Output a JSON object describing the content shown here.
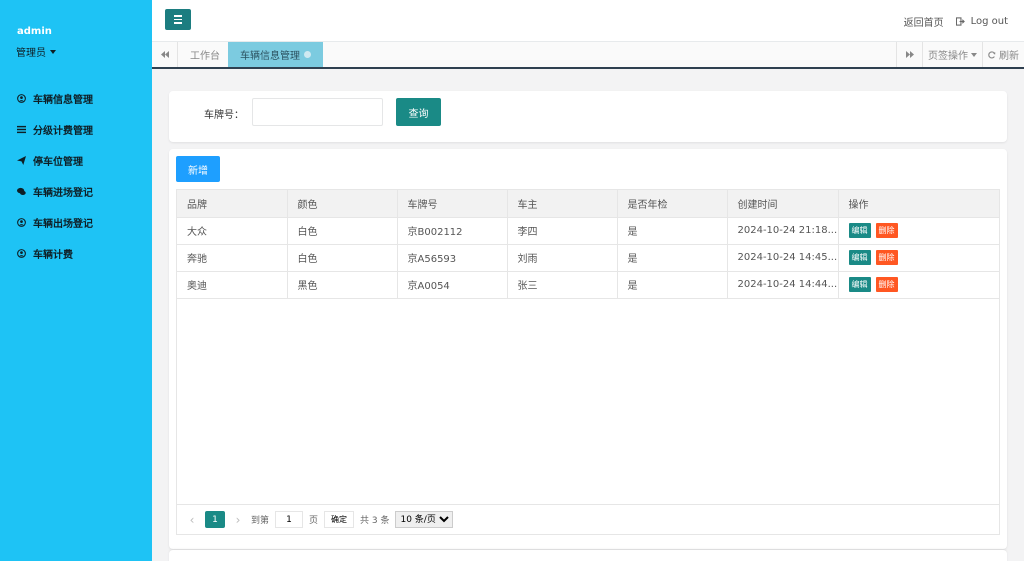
{
  "sidebar": {
    "user": "admin",
    "role": "管理员",
    "items": [
      {
        "label": "车辆信息管理",
        "icon": "user-circle-icon"
      },
      {
        "label": "分级计费管理",
        "icon": "list-icon"
      },
      {
        "label": "停车位管理",
        "icon": "paper-plane-icon"
      },
      {
        "label": "车辆进场登记",
        "icon": "comments-icon"
      },
      {
        "label": "车辆出场登记",
        "icon": "user-circle-icon"
      },
      {
        "label": "车辆计费",
        "icon": "user-circle-icon"
      }
    ]
  },
  "header": {
    "home_link": "返回首页",
    "logout": "Log out"
  },
  "tabs": {
    "items": [
      {
        "label": "工作台"
      },
      {
        "label": "车辆信息管理"
      }
    ],
    "page_ops": "页签操作",
    "refresh": "刷新"
  },
  "search": {
    "label": "车牌号：",
    "value": "",
    "query_button": "查询"
  },
  "toolbar": {
    "add_button": "新增"
  },
  "table": {
    "columns": [
      "品牌",
      "颜色",
      "车牌号",
      "车主",
      "是否年检",
      "创建时间",
      "操作"
    ],
    "rows": [
      {
        "brand": "大众",
        "color": "白色",
        "plate": "京B002112",
        "owner": "李四",
        "inspected": "是",
        "created": "2024-10-24 21:18..."
      },
      {
        "brand": "奔驰",
        "color": "白色",
        "plate": "京A56593",
        "owner": "刘雨",
        "inspected": "是",
        "created": "2024-10-24 14:45..."
      },
      {
        "brand": "奥迪",
        "color": "黑色",
        "plate": "京A0054",
        "owner": "张三",
        "inspected": "是",
        "created": "2024-10-24 14:44..."
      }
    ],
    "edit_label": "编辑",
    "delete_label": "删除"
  },
  "pager": {
    "current_page": "1",
    "goto_label": "到第",
    "goto_value": "1",
    "page_unit": "页",
    "confirm": "确定",
    "total": "共 3 条",
    "page_size": "10 条/页"
  },
  "colors": {
    "sidebar_bg": "#1ec3f5",
    "primary": "#1a8a86",
    "add_blue": "#1e9fff",
    "danger": "#ff5722"
  }
}
